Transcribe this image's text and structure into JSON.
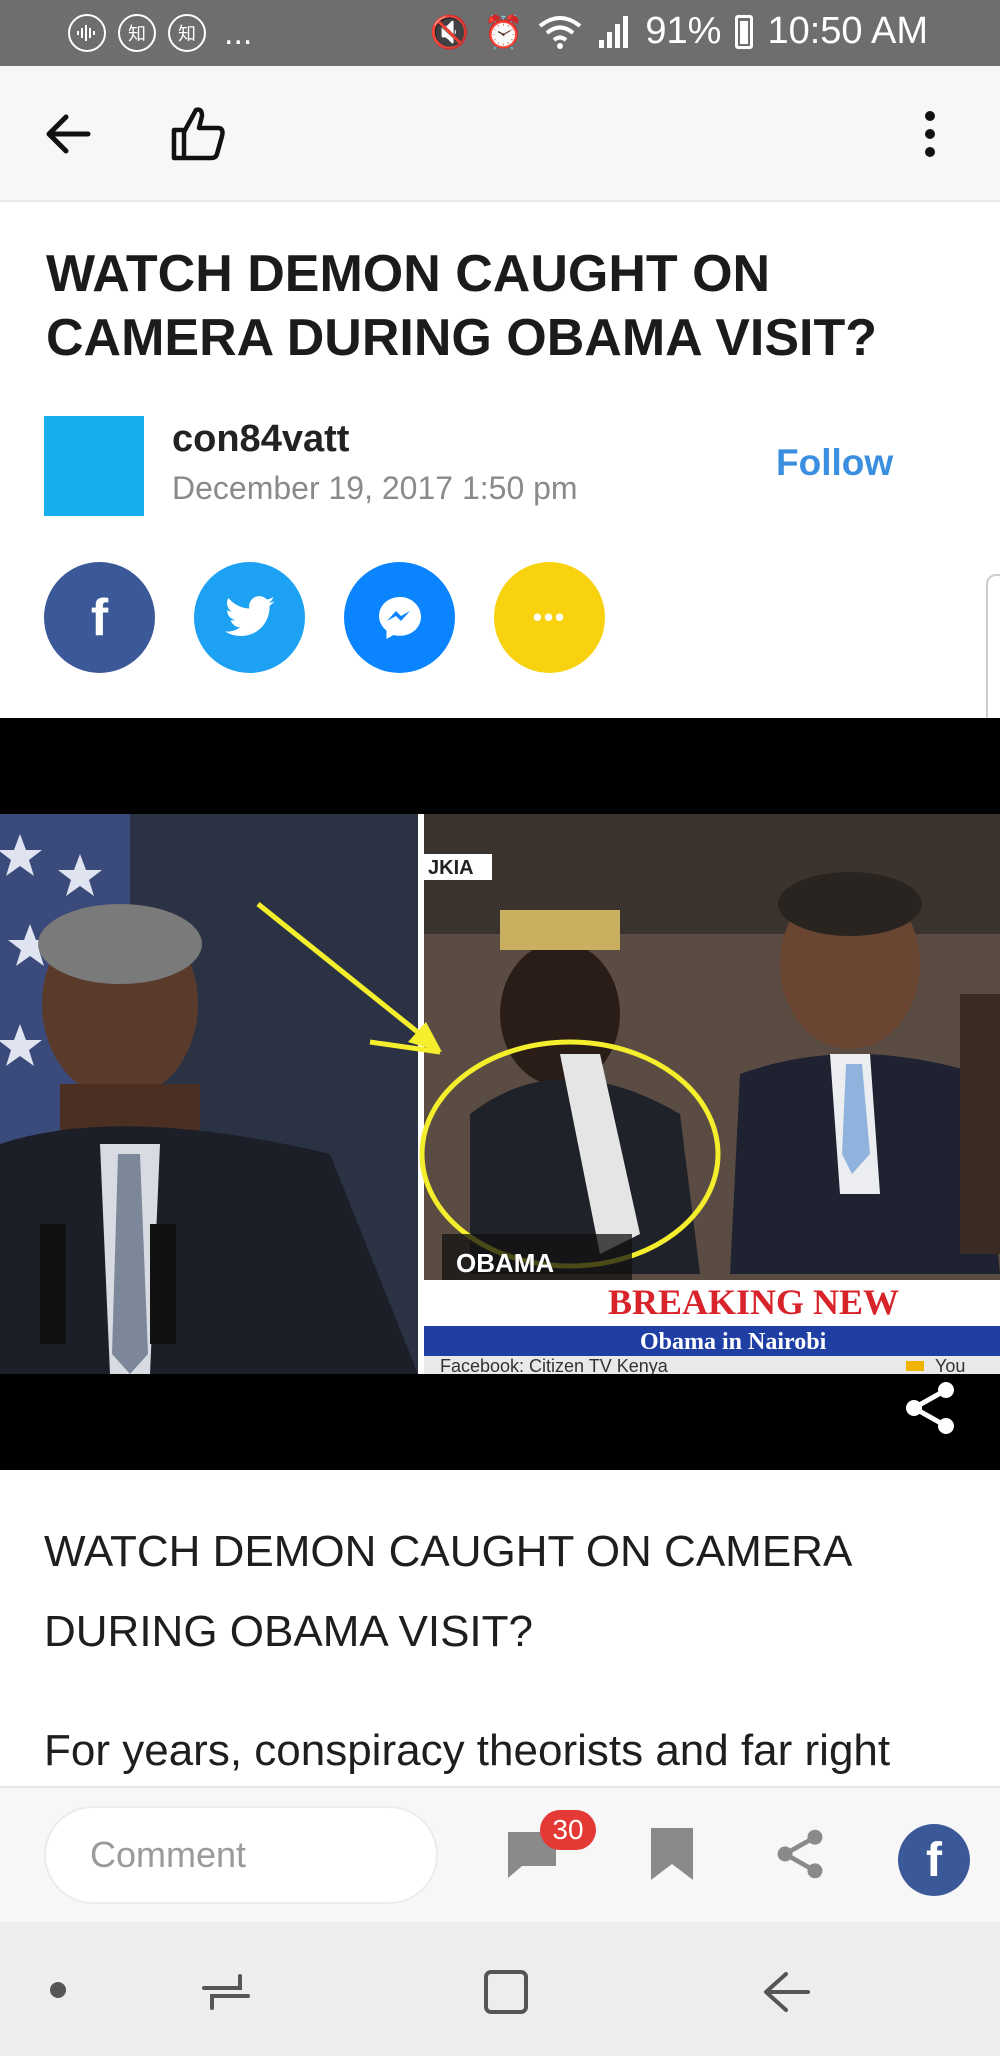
{
  "status_bar": {
    "app_icon_1": "知",
    "app_icon_2": "知",
    "more_dots": "...",
    "battery_percent": "91%",
    "time": "10:50 AM",
    "icons": [
      "waveform-icon",
      "mute-icon",
      "alarm-icon",
      "wifi-icon",
      "signal-icon",
      "battery-icon"
    ]
  },
  "app_bar": {
    "icons": [
      "back-arrow-icon",
      "thumbs-up-icon",
      "more-vertical-icon"
    ]
  },
  "article": {
    "headline": "WATCH DEMON CAUGHT ON CAMERA DURING OBAMA VISIT?",
    "author": "con84vatt",
    "date": "December 19, 2017 1:50 pm",
    "follow_label": "Follow",
    "avatar_color": "#16aeec",
    "share_buttons": [
      {
        "name": "facebook",
        "color": "#3b5998",
        "glyph": "f"
      },
      {
        "name": "twitter",
        "color": "#1da1f2"
      },
      {
        "name": "messenger",
        "color": "#0a84ff"
      },
      {
        "name": "more",
        "color": "#f8d20f",
        "glyph": "•••"
      }
    ],
    "image_overlay": {
      "channel_tag": "JKIA",
      "caption_tag": "OBAMA",
      "ticker_headline": "BREAKING NEW",
      "ticker_subline": "Obama in Nairobi",
      "ticker_footer": "Facebook: Citizen TV Kenya",
      "ticker_footer_2": "You"
    },
    "body_title": "WATCH DEMON CAUGHT ON CAMERA DURING OBAMA VISIT?",
    "body_paragraph_start": "For years, conspiracy theorists and far right"
  },
  "action_bar": {
    "comment_placeholder": "Comment",
    "comment_count": "30",
    "icons": [
      "comment-icon",
      "bookmark-icon",
      "share-icon",
      "facebook-icon"
    ]
  },
  "nav_bar": {
    "icons": [
      "dot-icon",
      "recent-apps-icon",
      "home-icon",
      "back-icon"
    ]
  }
}
